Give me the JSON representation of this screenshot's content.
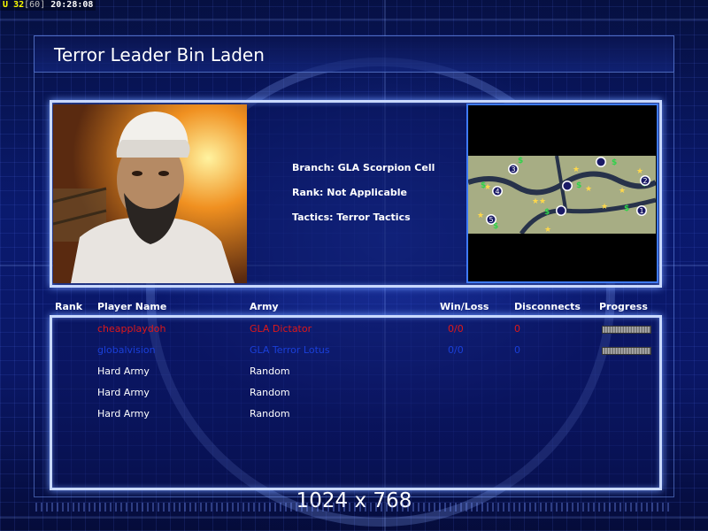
{
  "status_bar": {
    "u_label": "U",
    "unit_count": "32",
    "fps": "[60]",
    "clock": "20:28:08"
  },
  "title": "Terror Leader Bin Laden",
  "info": {
    "branch": "Branch: GLA Scorpion Cell",
    "rank": "Rank: Not Applicable",
    "tactics": "Tactics: Terror Tactics"
  },
  "map": {
    "start_positions": [
      "1",
      "2",
      "3",
      "4",
      "5"
    ],
    "colors": {
      "terrain": "#a7ad84",
      "river": "#27324a",
      "marker": "#1a1a66",
      "money": "#2fd34a",
      "star": "#ffd84a"
    }
  },
  "table": {
    "headers": {
      "rank": "Rank",
      "player": "Player Name",
      "army": "Army",
      "winloss": "Win/Loss",
      "disconnects": "Disconnects",
      "progress": "Progress"
    },
    "rows": [
      {
        "player": "cheapplaydoh",
        "army": "GLA Dictator",
        "winloss": "0/0",
        "disconnects": "0",
        "progress": true,
        "color": "#e01818"
      },
      {
        "player": "globalvision",
        "army": "GLA Terror Lotus",
        "winloss": "0/0",
        "disconnects": "0",
        "progress": true,
        "color": "#1a3fd9"
      },
      {
        "player": "Hard Army",
        "army": "Random",
        "winloss": "",
        "disconnects": "",
        "progress": false,
        "color": "#ffffff"
      },
      {
        "player": "Hard Army",
        "army": "Random",
        "winloss": "",
        "disconnects": "",
        "progress": false,
        "color": "#ffffff"
      },
      {
        "player": "Hard Army",
        "army": "Random",
        "winloss": "",
        "disconnects": "",
        "progress": false,
        "color": "#ffffff"
      }
    ]
  },
  "resolution": "1024 x 768"
}
